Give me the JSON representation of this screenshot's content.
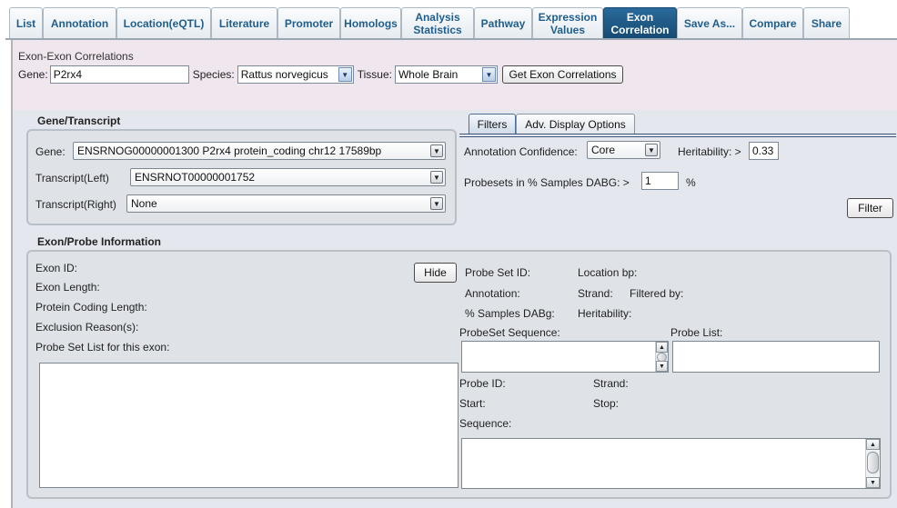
{
  "tabs": [
    {
      "label": "List"
    },
    {
      "label": "Annotation"
    },
    {
      "label": "Location(eQTL)"
    },
    {
      "label": "Literature"
    },
    {
      "label": "Promoter"
    },
    {
      "label": "Homologs"
    },
    {
      "label": "Analysis Statistics"
    },
    {
      "label": "Pathway"
    },
    {
      "label": "Expression Values"
    },
    {
      "label": "Exon Correlation",
      "active": true
    },
    {
      "label": "Save As..."
    },
    {
      "label": "Compare"
    },
    {
      "label": "Share"
    }
  ],
  "top": {
    "title": "Exon-Exon Correlations",
    "gene_label": "Gene:",
    "gene_value": "P2rx4",
    "species_label": "Species:",
    "species_value": "Rattus norvegicus",
    "tissue_label": "Tissue:",
    "tissue_value": "Whole Brain",
    "get_button": "Get Exon Correlations"
  },
  "gene_transcript": {
    "header": "Gene/Transcript",
    "gene_label": "Gene:",
    "gene_value": "ENSRNOG00000001300 P2rx4 protein_coding chr12 17589bp",
    "left_label": "Transcript(Left)",
    "left_value": "ENSRNOT00000001752",
    "right_label": "Transcript(Right)",
    "right_value": "None"
  },
  "filters": {
    "tab_filters": "Filters",
    "tab_adv": "Adv. Display Options",
    "confidence_label": "Annotation Confidence:",
    "confidence_value": "Core",
    "heritability_label": "Heritability: >",
    "heritability_value": "0.33",
    "dabg_label": "Probesets in % Samples DABG: >",
    "dabg_value": "1",
    "dabg_unit": "%",
    "filter_button": "Filter"
  },
  "exon_info": {
    "header": "Exon/Probe Information",
    "exon_id": "Exon ID:",
    "exon_length": "Exon Length:",
    "protein_coding_length": "Protein Coding Length:",
    "exclusion_reasons": "Exclusion Reason(s):",
    "probe_set_list": "Probe Set List for this exon:",
    "hide_button": "Hide",
    "probe_set_id": "Probe Set ID:",
    "location_bp": "Location bp:",
    "annotation": "Annotation:",
    "strand": "Strand:",
    "filtered_by": "Filtered by:",
    "samples_dabg": "% Samples DABg:",
    "heritability": "Heritability:",
    "probeset_sequence": "ProbeSet Sequence:",
    "probe_list": "Probe List:",
    "probe_id": "Probe ID:",
    "probe_strand": "Strand:",
    "start": "Start:",
    "stop": "Stop:",
    "sequence": "Sequence:"
  },
  "icons": {
    "dropdown": "chevron-down-icon",
    "scroll_up": "arrow-up-icon",
    "scroll_down": "arrow-down-icon"
  },
  "colors": {
    "tab_text": "#1f5e8c",
    "tab_active_bg": "#1f5a85",
    "top_bg": "#efe6ee",
    "panel_bg": "#e4e8ee"
  }
}
